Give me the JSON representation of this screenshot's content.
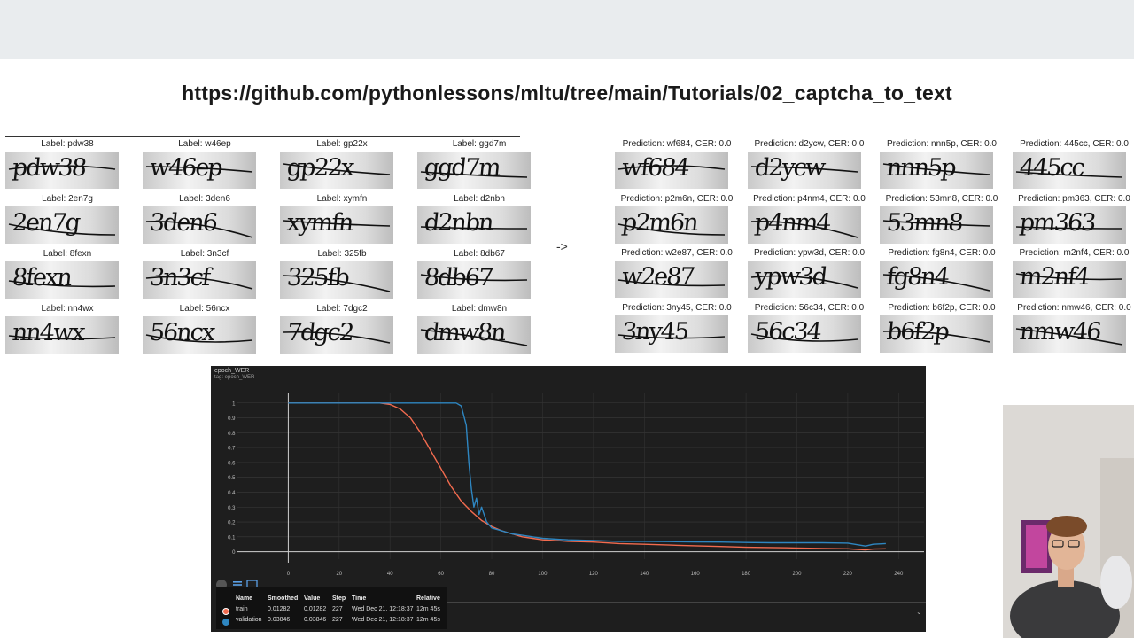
{
  "header": {
    "url": "https://github.com/pythonlessons/mltu/tree/main/Tutorials/02_captcha_to_text"
  },
  "labels": [
    {
      "label": "Label: pdw38",
      "captcha": "pdw38"
    },
    {
      "label": "Label: w46ep",
      "captcha": "w46ep"
    },
    {
      "label": "Label: gp22x",
      "captcha": "gp22x"
    },
    {
      "label": "Label: ggd7m",
      "captcha": "ggd7m"
    },
    {
      "label": "Label: 2en7g",
      "captcha": "2en7g"
    },
    {
      "label": "Label: 3den6",
      "captcha": "3den6"
    },
    {
      "label": "Label: xymfn",
      "captcha": "xymfn"
    },
    {
      "label": "Label: d2nbn",
      "captcha": "d2nbn"
    },
    {
      "label": "Label: 8fexn",
      "captcha": "8fexn"
    },
    {
      "label": "Label: 3n3cf",
      "captcha": "3n3cf"
    },
    {
      "label": "Label: 325fb",
      "captcha": "325fb"
    },
    {
      "label": "Label: 8db67",
      "captcha": "8db67"
    },
    {
      "label": "Label: nn4wx",
      "captcha": "nn4wx"
    },
    {
      "label": "Label: 56ncx",
      "captcha": "56ncx"
    },
    {
      "label": "Label: 7dgc2",
      "captcha": "7dgc2"
    },
    {
      "label": "Label: dmw8n",
      "captcha": "dmw8n"
    }
  ],
  "arrow": "->",
  "predictions": [
    {
      "label": "Prediction: wf684, CER: 0.0",
      "captcha": "wf684"
    },
    {
      "label": "Prediction: d2ycw, CER: 0.0",
      "captcha": "d2ycw"
    },
    {
      "label": "Prediction: nnn5p, CER: 0.0",
      "captcha": "nnn5p"
    },
    {
      "label": "Prediction: 445cc, CER: 0.0",
      "captcha": "445cc"
    },
    {
      "label": "Prediction: p2m6n, CER: 0.0",
      "captcha": "p2m6n"
    },
    {
      "label": "Prediction: p4nm4, CER: 0.0",
      "captcha": "p4nm4"
    },
    {
      "label": "Prediction: 53mn8, CER: 0.0",
      "captcha": "53mn8"
    },
    {
      "label": "Prediction: pm363, CER: 0.0",
      "captcha": "pm363"
    },
    {
      "label": "Prediction: w2e87, CER: 0.0",
      "captcha": "w2e87"
    },
    {
      "label": "Prediction: ypw3d, CER: 0.0",
      "captcha": "ypw3d"
    },
    {
      "label": "Prediction: fg8n4, CER: 0.0",
      "captcha": "fg8n4"
    },
    {
      "label": "Prediction: m2nf4, CER: 0.0",
      "captcha": "m2nf4"
    },
    {
      "label": "Prediction: 3ny45, CER: 0.0",
      "captcha": "3ny45"
    },
    {
      "label": "Prediction: 56c34, CER: 0.0",
      "captcha": "56c34"
    },
    {
      "label": "Prediction: b6f2p, CER: 0.0",
      "captcha": "b6f2p"
    },
    {
      "label": "Prediction: nmw46, CER: 0.0",
      "captcha": "nmw46"
    }
  ],
  "board": {
    "title": "epoch_WER",
    "tag": "tag: epoch_WER",
    "tooltip": {
      "headers": {
        "name": "Name",
        "smoothed": "Smoothed",
        "value": "Value",
        "step": "Step",
        "time": "Time",
        "relative": "Relative"
      },
      "rows": [
        {
          "name": "train",
          "smoothed": "0.01282",
          "value": "0.01282",
          "step": "227",
          "time": "Wed Dec 21, 12:18:37",
          "relative": "12m 45s",
          "color": "#f26b4f"
        },
        {
          "name": "validation",
          "smoothed": "0.03846",
          "value": "0.03846",
          "step": "227",
          "time": "Wed Dec 21, 12:18:37",
          "relative": "12m 45s",
          "color": "#2e86c1"
        }
      ]
    }
  },
  "chart_data": {
    "type": "line",
    "title": "epoch_WER",
    "xlabel": "",
    "ylabel": "",
    "xlim": [
      -20,
      250
    ],
    "ylim": [
      -0.05,
      1.07
    ],
    "xticks": [
      "0",
      "20",
      "40",
      "60",
      "80",
      "100",
      "120",
      "140",
      "160",
      "180",
      "200",
      "220",
      "240"
    ],
    "yticks": [
      "0",
      "0.1",
      "0.2",
      "0.3",
      "0.4",
      "0.5",
      "0.6",
      "0.7",
      "0.8",
      "0.9",
      "1"
    ],
    "grid": true,
    "series": [
      {
        "name": "train",
        "color": "#f26b4f",
        "x": [
          0,
          20,
          36,
          40,
          44,
          48,
          52,
          56,
          60,
          64,
          68,
          72,
          76,
          80,
          84,
          88,
          92,
          96,
          100,
          110,
          120,
          130,
          140,
          150,
          160,
          170,
          180,
          190,
          200,
          210,
          220,
          227,
          230,
          235
        ],
        "y": [
          1,
          1,
          1,
          0.99,
          0.96,
          0.9,
          0.8,
          0.68,
          0.56,
          0.44,
          0.34,
          0.27,
          0.21,
          0.17,
          0.14,
          0.12,
          0.1,
          0.09,
          0.08,
          0.07,
          0.065,
          0.055,
          0.05,
          0.045,
          0.04,
          0.035,
          0.03,
          0.028,
          0.025,
          0.022,
          0.02,
          0.01282,
          0.018,
          0.02
        ]
      },
      {
        "name": "validation",
        "color": "#2e86c1",
        "x": [
          0,
          20,
          40,
          60,
          66,
          68,
          70,
          71,
          72,
          73,
          74,
          75,
          76,
          78,
          80,
          84,
          88,
          92,
          96,
          100,
          110,
          120,
          130,
          140,
          150,
          160,
          170,
          180,
          190,
          200,
          210,
          220,
          227,
          230,
          235
        ],
        "y": [
          1,
          1,
          1,
          1,
          1,
          0.98,
          0.85,
          0.6,
          0.42,
          0.3,
          0.36,
          0.25,
          0.3,
          0.2,
          0.16,
          0.14,
          0.12,
          0.11,
          0.1,
          0.09,
          0.08,
          0.075,
          0.07,
          0.07,
          0.068,
          0.066,
          0.065,
          0.062,
          0.06,
          0.06,
          0.06,
          0.058,
          0.03846,
          0.05,
          0.055
        ]
      }
    ]
  }
}
